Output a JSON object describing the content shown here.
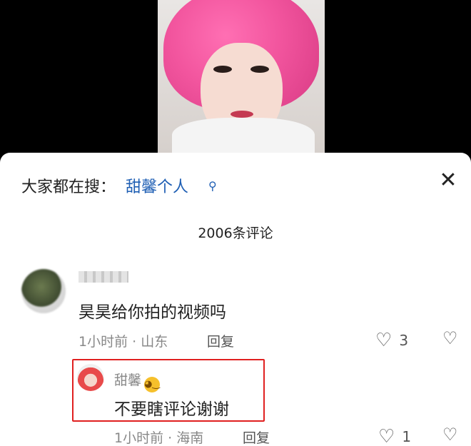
{
  "search": {
    "prefix": "大家都在搜：",
    "term": "甜馨个人",
    "icon": "search-icon"
  },
  "close": {
    "glyph": "✕"
  },
  "comments_count": "2006条评论",
  "comment": {
    "text": "昊昊给你拍的视频吗",
    "meta": "1小时前 · 山东",
    "reply_label": "回复",
    "likes": "3"
  },
  "reply": {
    "username": "甜馨",
    "emoji": "wink-emoji",
    "text": "不要瞎评论谢谢",
    "meta": "1小时前 · 海南",
    "reply_label": "回复",
    "likes": "1"
  },
  "colors": {
    "accent": "#1f5fb4",
    "highlight": "#e02020",
    "hair": "#f2559e"
  }
}
